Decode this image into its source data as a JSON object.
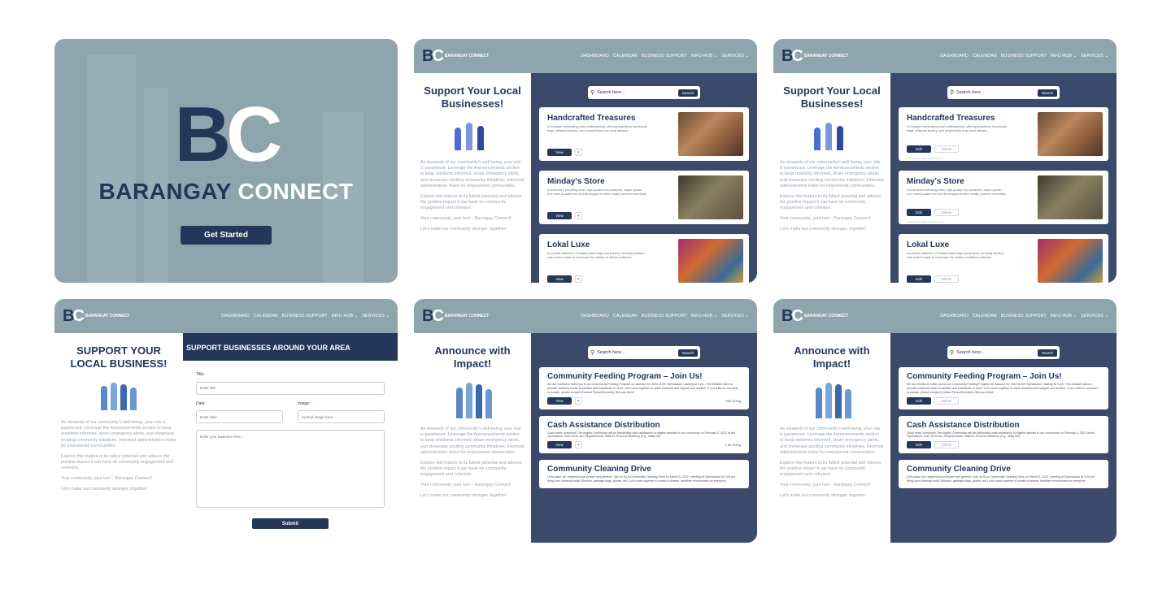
{
  "splash": {
    "mark": "B",
    "mark_c": "C",
    "brand_dark": "BARANGAY",
    "brand_light": "CONNECT",
    "cta": "Get Started"
  },
  "nav": {
    "logo_dark": "BARANGAY",
    "logo_light": "CONNECT",
    "links": [
      "DASHBOARD",
      "CALENDAR",
      "BUSINESS SUPPORT",
      "INFO HUB ⌄",
      "SERVICES ⌄"
    ]
  },
  "sidebar": {
    "business_title": "Support Your Local Businesses!",
    "form_title": "SUPPORT YOUR LOCAL BUSINESS!",
    "announce_title": "Announce with Impact!",
    "p1": "As stewards of our community's well-being, your role is paramount. Leverage the Announcements section to keep residents informed, share emergency alerts, and showcase exciting community initiatives. Informed administrators make for empowered communities.",
    "p2": "Explore this feature to its fullest potential and witness the positive impact it can have on community engagement and cohesion.",
    "p3": "Your community, your tool – Barangay Connect!",
    "p4": "Let's make our community stronger, together!"
  },
  "search": {
    "placeholder": "Search here...",
    "button": "Search"
  },
  "buttons": {
    "view": "View",
    "edit": "Edit",
    "delete": "Delete",
    "heart": "♥"
  },
  "businesses": [
    {
      "title": "Handcrafted Treasures",
      "desc": "A boutique celebrating local craftsmanship, offering beautifully handmade bags, artisanal jewelry, and unique finds from local artisans."
    },
    {
      "title": "Minday's Store",
      "desc": "A local store providing fresh, high-quality food products, staple goods, from farm-to-table rice and beverages to other locally sourced essentials."
    },
    {
      "title": "Lokal Luxe",
      "desc": "A curated collection of locally made bags and jewelry, blending tradition with modern style to showcase the artistry of skilled craftsmen."
    }
  ],
  "form": {
    "header": "SUPPORT BUSINESSES AROUND YOUR AREA",
    "title_label": "Title:",
    "title_placeholder": "Enter title",
    "date_label": "Date:",
    "date_placeholder": "Enter date",
    "image_label": "Image:",
    "image_placeholder": "Upload image here",
    "body_placeholder": "Enter your business here...",
    "submit": "Submit"
  },
  "announcements": [
    {
      "title": "Community Feeding Program – Join Us!",
      "desc": "We are excited to invite you to our Community Feeding Program on January 20, 2022 at the Gymnasium, starting at 3 pm. This initiative aims to provide nutritious meals to families and individuals in need. Let's come together to share kindness and support one another. If you'd like to volunteer or donate, please contact [Contact Person/Number]. See you there!",
      "going": "500 Going"
    },
    {
      "title": "Cash Assistance Distribution",
      "desc": "Good news, everyone! The Angels Community will be distributing cash assistance to eligible families in our community on February 2, 2022 at the Gymnasium, from 10:00 am. Requirements: Valid ID; Proof of residency (e.g., utility bill)",
      "going": "1.5k Going"
    },
    {
      "title": "Community Cleaning Drive",
      "desc": "Let's make our neighborhood cleaner and greener! Join us for a Community Cleaning Drive on March 5, 2022, meeting at Gymnasium at 3:00 pm. Bring your cleaning tools! (Brooms, garbage bags, gloves, etc.) Let's work together to create a cleaner, healthier environment for everyone.",
      "going": ""
    }
  ],
  "updated": "Last Updated: 08/11/2023 10:00 am"
}
